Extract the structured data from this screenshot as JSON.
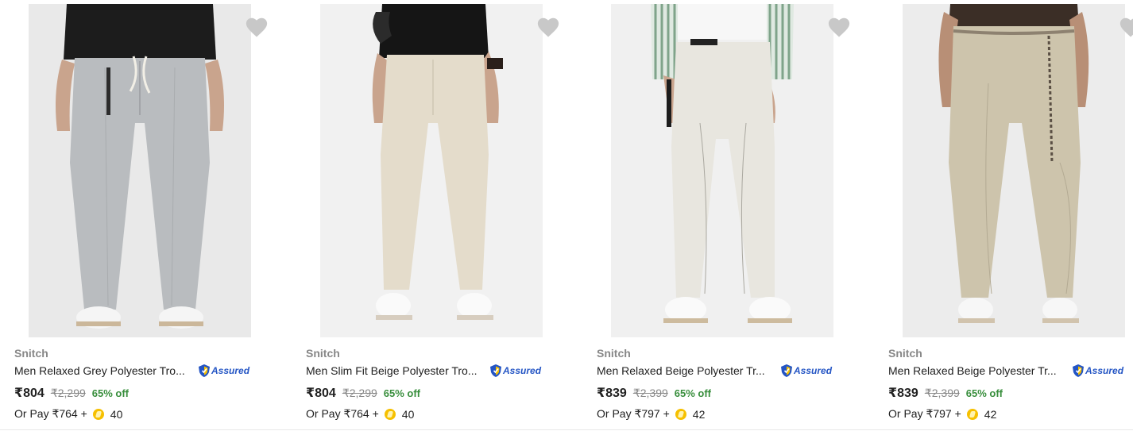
{
  "products": [
    {
      "brand": "Snitch",
      "title": "Men Relaxed Grey Polyester Tro...",
      "assured_label": "Assured",
      "price": "₹804",
      "mrp": "₹2,299",
      "discount": "65% off",
      "pay_prefix": "Or Pay ₹764 +",
      "coins": "40",
      "pant_color": "#b9bcbf",
      "bg_color": "#e9e9e9",
      "top_color": "#1c1c1c",
      "image_icon": "product-image"
    },
    {
      "brand": "Snitch",
      "title": "Men Slim Fit Beige Polyester Tro...",
      "assured_label": "Assured",
      "price": "₹804",
      "mrp": "₹2,299",
      "discount": "65% off",
      "pay_prefix": "Or Pay ₹764 +",
      "coins": "40",
      "pant_color": "#e4dccb",
      "bg_color": "#f1f1f1",
      "top_color": "#151515",
      "image_icon": "product-image"
    },
    {
      "brand": "Snitch",
      "title": "Men Relaxed Beige Polyester Tr...",
      "assured_label": "Assured",
      "price": "₹839",
      "mrp": "₹2,399",
      "discount": "65% off",
      "pay_prefix": "Or Pay ₹797 +",
      "coins": "42",
      "pant_color": "#e8e6df",
      "bg_color": "#f0f0f0",
      "top_color": "#7fa48a",
      "image_icon": "product-image"
    },
    {
      "brand": "Snitch",
      "title": "Men Relaxed Beige Polyester Tr...",
      "assured_label": "Assured",
      "price": "₹839",
      "mrp": "₹2,399",
      "discount": "65% off",
      "pay_prefix": "Or Pay ₹797 +",
      "coins": "42",
      "pant_color": "#cdc4ac",
      "bg_color": "#ececec",
      "top_color": "#3b2e26",
      "image_icon": "product-image"
    }
  ],
  "colors": {
    "heart": "#c8c8c8",
    "assured_blue": "#2455c4",
    "assured_gold": "#f6c000",
    "discount_green": "#388e3c"
  }
}
